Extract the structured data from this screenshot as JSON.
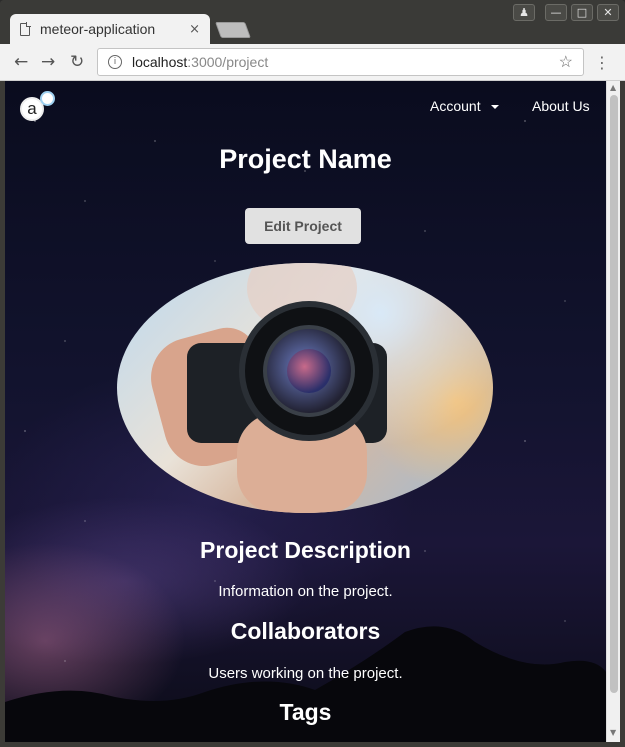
{
  "browser": {
    "tab_title": "meteor-application",
    "tab_close": "×",
    "url_host": "localhost",
    "url_path": ":3000/project",
    "window_controls": [
      "user-icon",
      "minimize-icon",
      "maximize-icon",
      "close-icon"
    ]
  },
  "nav": {
    "logo_letter": "a",
    "account_label": "Account",
    "about_label": "About Us"
  },
  "project": {
    "name": "Project Name",
    "edit_label": "Edit Project",
    "description_heading": "Project Description",
    "description_text": "Information on the project.",
    "collaborators_heading": "Collaborators",
    "collaborators_text": "Users working on the project.",
    "tags_heading": "Tags"
  },
  "colors": {
    "edit_button_bg": "#e1e1e1",
    "heading_text": "#ffffff",
    "background_top": "#0a0c1e"
  }
}
